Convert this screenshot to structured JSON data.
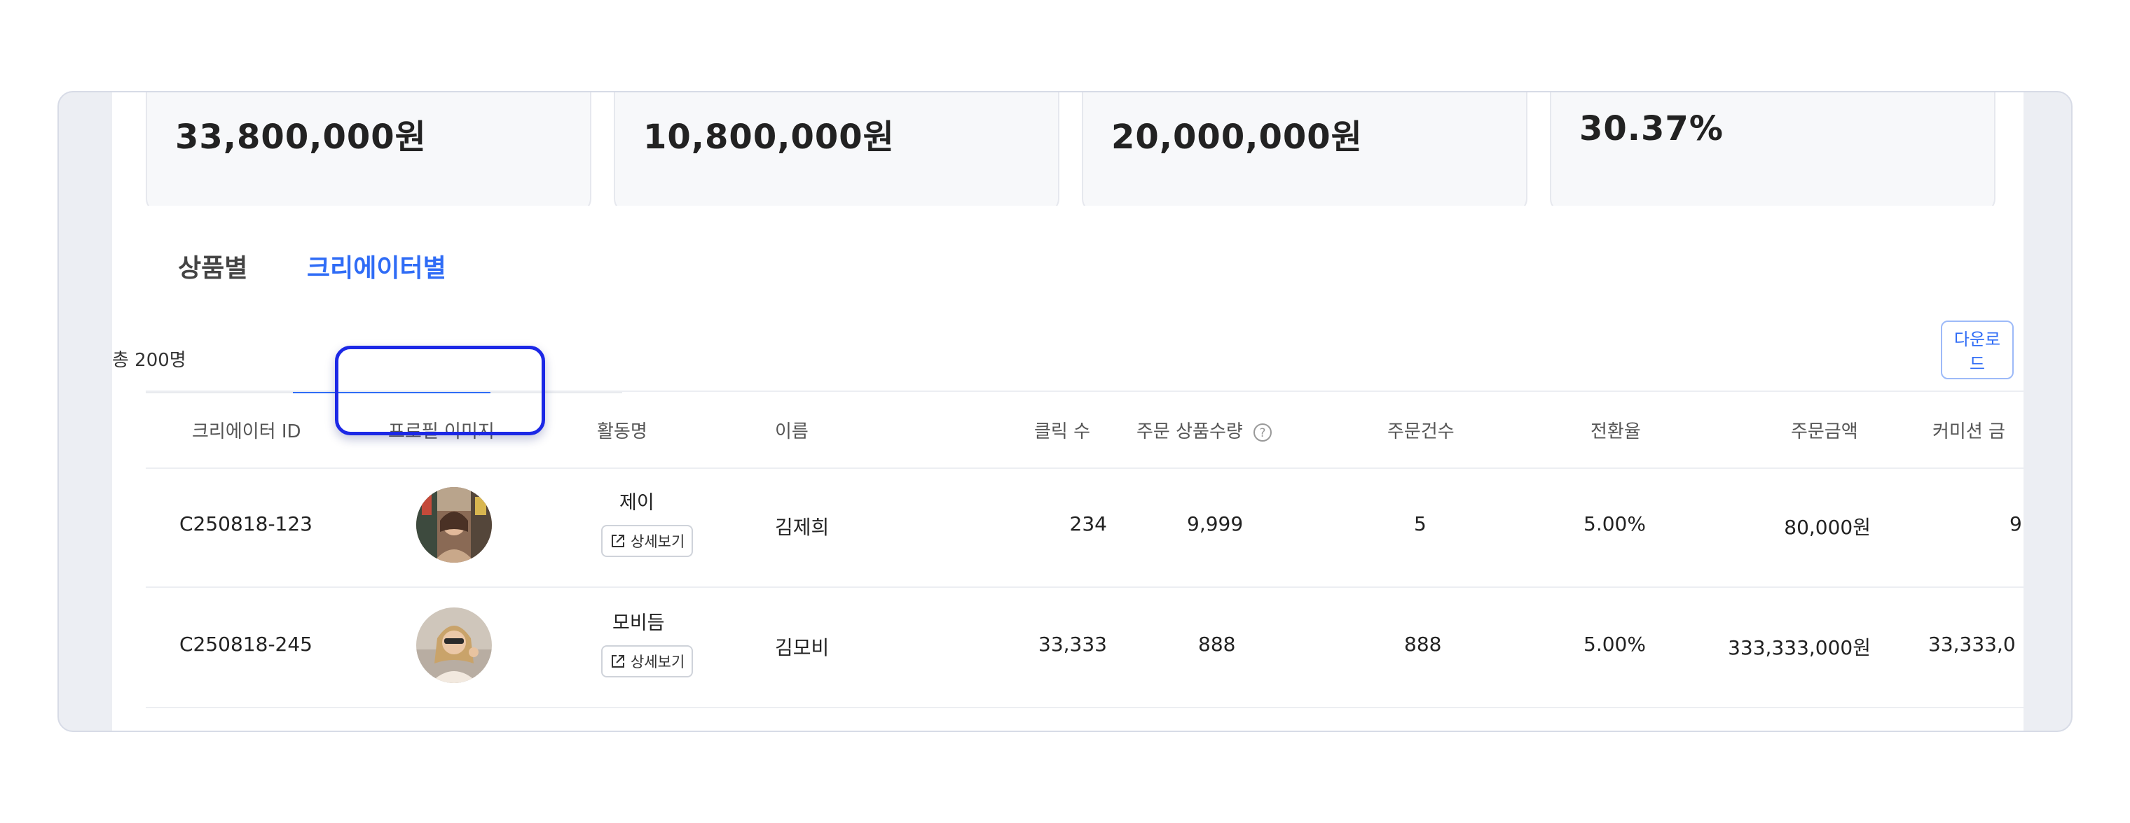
{
  "summary": {
    "cards": [
      {
        "value": "33,800,000원"
      },
      {
        "value": "10,800,000원"
      },
      {
        "value": "20,000,000원"
      },
      {
        "value": "30.37%"
      }
    ]
  },
  "tabs": {
    "product": "상품별",
    "creator": "크리에이터별"
  },
  "list": {
    "total": "총 200명",
    "download_label": "다운로드"
  },
  "table": {
    "headers": {
      "creator_id": "크리에이터 ID",
      "profile_image": "프로필 이미지",
      "activity_name": "활동명",
      "name": "이름",
      "clicks": "클릭 수",
      "order_qty": "주문 상품수량",
      "order_count": "주문건수",
      "conversion": "전환율",
      "order_amount": "주문금액",
      "commission": "커미션 금"
    },
    "detail_label": "상세보기",
    "rows": [
      {
        "creator_id": "C250818-123",
        "activity_name": "제이",
        "name": "김제희",
        "clicks": "234",
        "order_qty": "9,999",
        "order_count": "5",
        "conversion": "5.00%",
        "order_amount": "80,000원",
        "commission": "9"
      },
      {
        "creator_id": "C250818-245",
        "activity_name": "모비듬",
        "name": "김모비",
        "clicks": "33,333",
        "order_qty": "888",
        "order_count": "888",
        "conversion": "5.00%",
        "order_amount": "333,333,000원",
        "commission": "33,333,0"
      }
    ]
  },
  "colors": {
    "accent": "#2f6cf6",
    "focus_ring": "#1c28e6",
    "frame_bg": "#eceef3"
  }
}
